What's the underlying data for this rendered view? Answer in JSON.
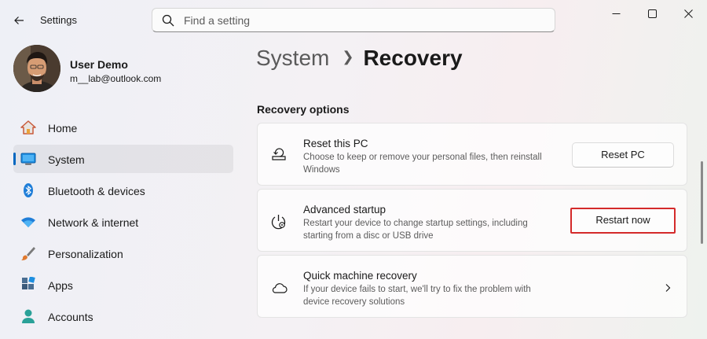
{
  "window": {
    "app_title": "Settings",
    "controls": {
      "minimize_icon": "minimize-icon",
      "maximize_icon": "maximize-icon",
      "close_icon": "close-icon"
    }
  },
  "search": {
    "placeholder": "Find a setting",
    "value": ""
  },
  "profile": {
    "name": "User Demo",
    "email": "m__lab@outlook.com"
  },
  "nav": {
    "items": [
      {
        "label": "Home",
        "icon": "home-icon",
        "active": false
      },
      {
        "label": "System",
        "icon": "system-icon",
        "active": true
      },
      {
        "label": "Bluetooth & devices",
        "icon": "bluetooth-icon",
        "active": false
      },
      {
        "label": "Network & internet",
        "icon": "wifi-icon",
        "active": false
      },
      {
        "label": "Personalization",
        "icon": "brush-icon",
        "active": false
      },
      {
        "label": "Apps",
        "icon": "apps-icon",
        "active": false
      },
      {
        "label": "Accounts",
        "icon": "accounts-icon",
        "active": false
      }
    ]
  },
  "breadcrumb": {
    "parent": "System",
    "current": "Recovery"
  },
  "section": {
    "title": "Recovery options"
  },
  "cards": [
    {
      "title": "Reset this PC",
      "description": "Choose to keep or remove your personal files, then reinstall Windows",
      "icon": "reset-pc-icon",
      "button_label": "Reset PC"
    },
    {
      "title": "Advanced startup",
      "description": "Restart your device to change startup settings, including starting from a disc or USB drive",
      "icon": "advanced-startup-icon",
      "button_label": "Restart now",
      "highlighted": true
    },
    {
      "title": "Quick machine recovery",
      "description": "If your device fails to start, we'll try to fix the problem with device recovery solutions",
      "icon": "cloud-icon",
      "action_icon": "chevron-right-icon"
    }
  ],
  "colors": {
    "accent": "#0067c0",
    "highlight_border": "#d42a2a"
  }
}
